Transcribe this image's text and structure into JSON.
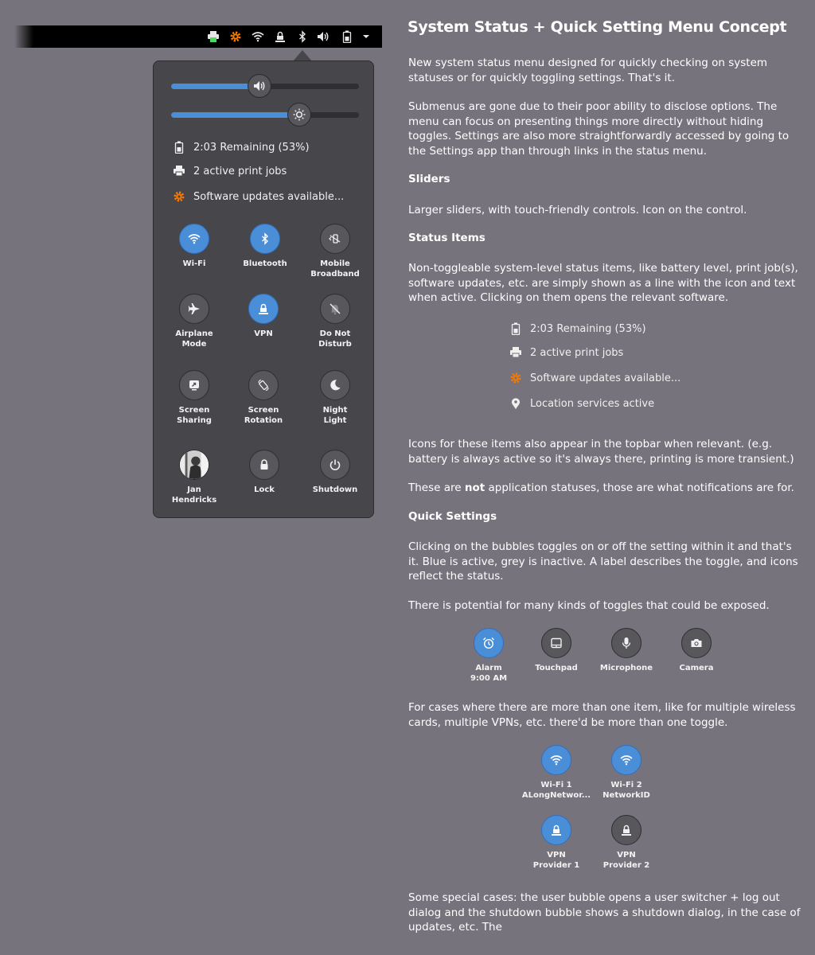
{
  "topbar": {
    "icons": [
      "printer-icon",
      "software-update-icon",
      "wifi-icon",
      "vpn-icon",
      "bluetooth-icon",
      "volume-icon",
      "battery-icon",
      "dropdown-arrow-icon"
    ]
  },
  "menu": {
    "sliders": [
      {
        "name": "volume",
        "icon": "volume-icon",
        "level": 0.47
      },
      {
        "name": "brightness",
        "icon": "brightness-icon",
        "level": 0.68
      }
    ],
    "status_items": [
      {
        "icon": "battery-icon",
        "label": "2:03 Remaining (53%)"
      },
      {
        "icon": "printer-icon",
        "label": "2 active print jobs"
      },
      {
        "icon": "software-update-icon",
        "label": "Software updates available..."
      }
    ],
    "toggles": [
      {
        "label": "Wi-Fi",
        "icon": "wifi-icon",
        "state": "on"
      },
      {
        "label": "Bluetooth",
        "icon": "bluetooth-icon",
        "state": "on"
      },
      {
        "label": "Mobile\nBroadband",
        "icon": "mobile-broadband-icon",
        "state": "off"
      },
      {
        "label": "Airplane\nMode",
        "icon": "airplane-icon",
        "state": "off"
      },
      {
        "label": "VPN",
        "icon": "vpn-icon",
        "state": "on"
      },
      {
        "label": "Do Not\nDisturb",
        "icon": "do-not-disturb-icon",
        "state": "off"
      },
      {
        "label": "Screen\nSharing",
        "icon": "screen-sharing-icon",
        "state": "off"
      },
      {
        "label": "Screen\nRotation",
        "icon": "screen-rotation-icon",
        "state": "off"
      },
      {
        "label": "Night\nLight",
        "icon": "night-light-icon",
        "state": "off"
      },
      {
        "label": "Jan\nHendricks",
        "icon": "user-avatar",
        "state": "off"
      },
      {
        "label": "Lock",
        "icon": "lock-icon",
        "state": "off"
      },
      {
        "label": "Shutdown",
        "icon": "power-icon",
        "state": "off"
      }
    ]
  },
  "article": {
    "title": "System Status + Quick Setting Menu Concept",
    "intro": "New system status menu designed for quickly checking on system statuses or for quickly toggling settings. That's it.",
    "submenus": "Submenus are gone due to their poor ability to disclose options. The menu can focus on presenting things more directly without hiding toggles. Settings are also more straightforwardly accessed by going to the Settings app than through links in the status menu.",
    "sliders_heading": "Sliders",
    "sliders_text": "Larger sliders, with touch-friendly controls. Icon on the control.",
    "status_heading": "Status Items",
    "status_text": "Non-toggleable system-level status items, like battery level, print job(s), software updates, etc. are simply shown as a line with the icon and text when active. Clicking on them opens the relevant software.",
    "status_examples": [
      {
        "icon": "battery-icon",
        "label": "2:03 Remaining (53%)"
      },
      {
        "icon": "printer-icon",
        "label": "2 active print jobs"
      },
      {
        "icon": "software-update-icon",
        "label": "Software updates available..."
      },
      {
        "icon": "location-icon",
        "label": "Location services active"
      }
    ],
    "topbar_note": "Icons for these items also appear in the topbar when relevant. (e.g. battery is always active so it's always there, printing is more transient.)",
    "not_statuses_before": "These are ",
    "not_statuses_bold": "not",
    "not_statuses_after": " application statuses, those are what notifications are for.",
    "quick_heading": "Quick Settings",
    "quick_text": "Clicking on the bubbles toggles on or off the setting within it and that's it. Blue is active, grey is inactive. A label describes the toggle, and icons reflect the status.",
    "potential_text": "There is potential for many kinds of toggles that could be exposed.",
    "example_toggles": [
      {
        "label": "Alarm\n9:00 AM",
        "icon": "alarm-icon",
        "state": "on"
      },
      {
        "label": "Touchpad",
        "icon": "touchpad-icon",
        "state": "off"
      },
      {
        "label": "Microphone",
        "icon": "microphone-icon",
        "state": "off"
      },
      {
        "label": "Camera",
        "icon": "camera-icon",
        "state": "off"
      }
    ],
    "multiple_text": "For cases where there are more than one item, like for multiple wireless cards, multiple VPNs, etc. there'd be more than one toggle.",
    "multi_toggles": [
      {
        "label": "Wi-Fi 1\nALongNetwor...",
        "icon": "wifi-icon",
        "state": "on"
      },
      {
        "label": "Wi-Fi 2\nNetworkID",
        "icon": "wifi-icon",
        "state": "on"
      },
      {
        "label": "VPN\nProvider 1",
        "icon": "vpn-icon",
        "state": "on"
      },
      {
        "label": "VPN\nProvider 2",
        "icon": "vpn-icon",
        "state": "off"
      }
    ],
    "special_text": "Some special cases: the user bubble opens a user switcher + log out dialog and the shutdown bubble shows a shutdown dialog, in the case of updates, etc. The"
  },
  "colors": {
    "background": "#76737c",
    "menu": "#47464b",
    "active": "#4a8ed8",
    "inactive": "#58575c",
    "update_orange": "#f57900",
    "print_green": "#4cd964"
  }
}
